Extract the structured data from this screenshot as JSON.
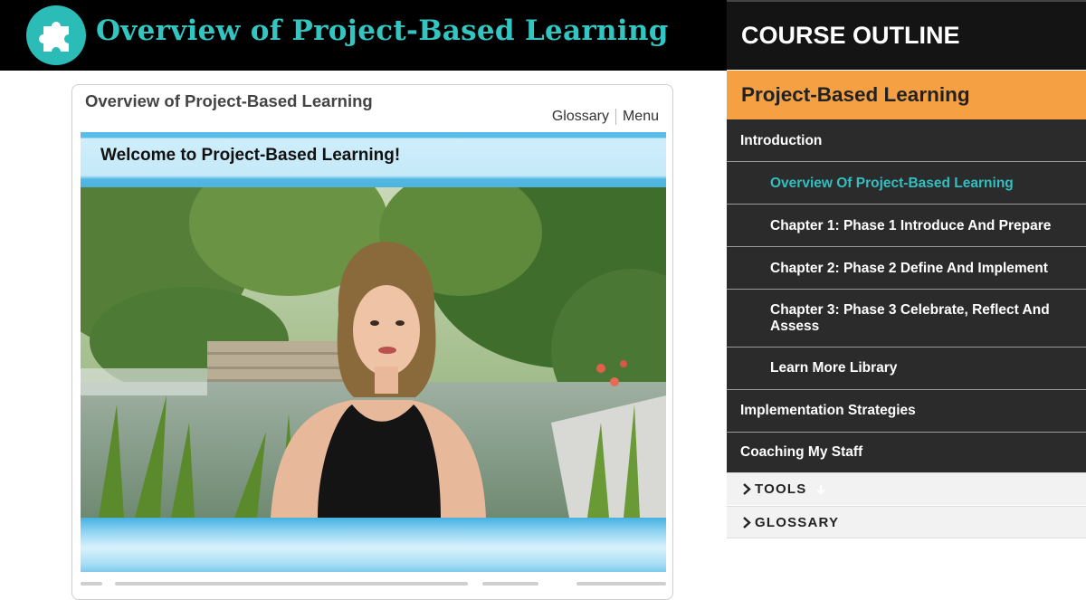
{
  "header": {
    "title": "Overview of Project-Based Learning",
    "logo_icon": "puzzle-piece-icon",
    "title_color": "#33c5c1"
  },
  "player": {
    "title": "Overview of Project-Based Learning",
    "links": {
      "glossary": "Glossary",
      "menu": "Menu"
    },
    "slide_heading": "Welcome to Project-Based Learning!"
  },
  "outline": {
    "heading": "COURSE OUTLINE",
    "course_name": "Project-Based Learning",
    "accent_color": "#f5a043",
    "items": [
      {
        "label": "Introduction",
        "level": 1
      },
      {
        "label": "Overview Of Project-Based Learning",
        "level": 2,
        "active": true
      },
      {
        "label": "Chapter 1: Phase 1 Introduce And Prepare",
        "level": 2
      },
      {
        "label": "Chapter 2: Phase 2 Define And Implement",
        "level": 2
      },
      {
        "label": "Chapter 3: Phase 3 Celebrate, Reflect And Assess",
        "level": 2
      },
      {
        "label": "Learn More Library",
        "level": 2
      },
      {
        "label": "Implementation Strategies",
        "level": 1
      },
      {
        "label": "Coaching My Staff",
        "level": 1
      }
    ],
    "tools_label": "TOOLS",
    "glossary_label": "GLOSSARY",
    "active_color": "#31bfc1"
  }
}
